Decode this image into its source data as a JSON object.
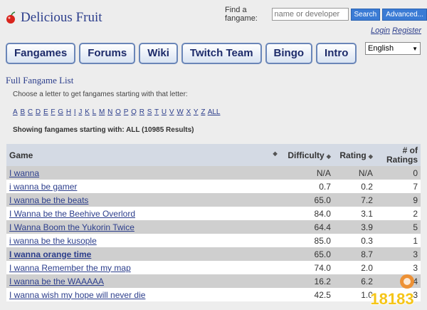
{
  "header": {
    "logo_text": "Delicious Fruit",
    "search_label": "Find a fangame:",
    "search_placeholder": "name or developer",
    "search_button": "Search",
    "advanced_button": "Advanced...",
    "login": "Login",
    "register": "Register",
    "language": "English"
  },
  "nav": [
    "Fangames",
    "Forums",
    "Wiki",
    "Twitch Team",
    "Bingo",
    "Intro"
  ],
  "main": {
    "title": "Full Fangame List",
    "instruction": "Choose a letter to get fangames starting with that letter:",
    "letters": [
      "A",
      "B",
      "C",
      "D",
      "E",
      "F",
      "G",
      "H",
      "I",
      "J",
      "K",
      "L",
      "M",
      "N",
      "O",
      "P",
      "Q",
      "R",
      "S",
      "T",
      "U",
      "V",
      "W",
      "X",
      "Y",
      "Z",
      "ALL"
    ],
    "showing": "Showing fangames starting with: ALL (10985 Results)"
  },
  "table": {
    "headers": {
      "game": "Game",
      "difficulty": "Difficulty",
      "rating": "Rating",
      "num_ratings": "# of Ratings"
    },
    "rows": [
      {
        "game": "I wanna",
        "difficulty": "N/A",
        "rating": "N/A",
        "count": "0"
      },
      {
        "game": "i wanna be gamer",
        "difficulty": "0.7",
        "rating": "0.2",
        "count": "7"
      },
      {
        "game": "I wanna be the beats",
        "difficulty": "65.0",
        "rating": "7.2",
        "count": "9"
      },
      {
        "game": "I Wanna be the Beehive Overlord",
        "difficulty": "84.0",
        "rating": "3.1",
        "count": "2"
      },
      {
        "game": "I Wanna Boom the Yukorin Twice",
        "difficulty": "64.4",
        "rating": "3.9",
        "count": "5"
      },
      {
        "game": "i wanna be the kusople",
        "difficulty": "85.0",
        "rating": "0.3",
        "count": "1"
      },
      {
        "game": "I wanna orange time",
        "difficulty": "65.0",
        "rating": "8.7",
        "count": "3"
      },
      {
        "game": "I wanna Remember the my map",
        "difficulty": "74.0",
        "rating": "2.0",
        "count": "3"
      },
      {
        "game": "I wanna be the WAAAAA",
        "difficulty": "16.2",
        "rating": "6.2",
        "count": "4"
      },
      {
        "game": "I wanna wish my hope will never die",
        "difficulty": "42.5",
        "rating": "1.0",
        "count": "3"
      }
    ]
  },
  "watermark": {
    "text": "18183"
  }
}
